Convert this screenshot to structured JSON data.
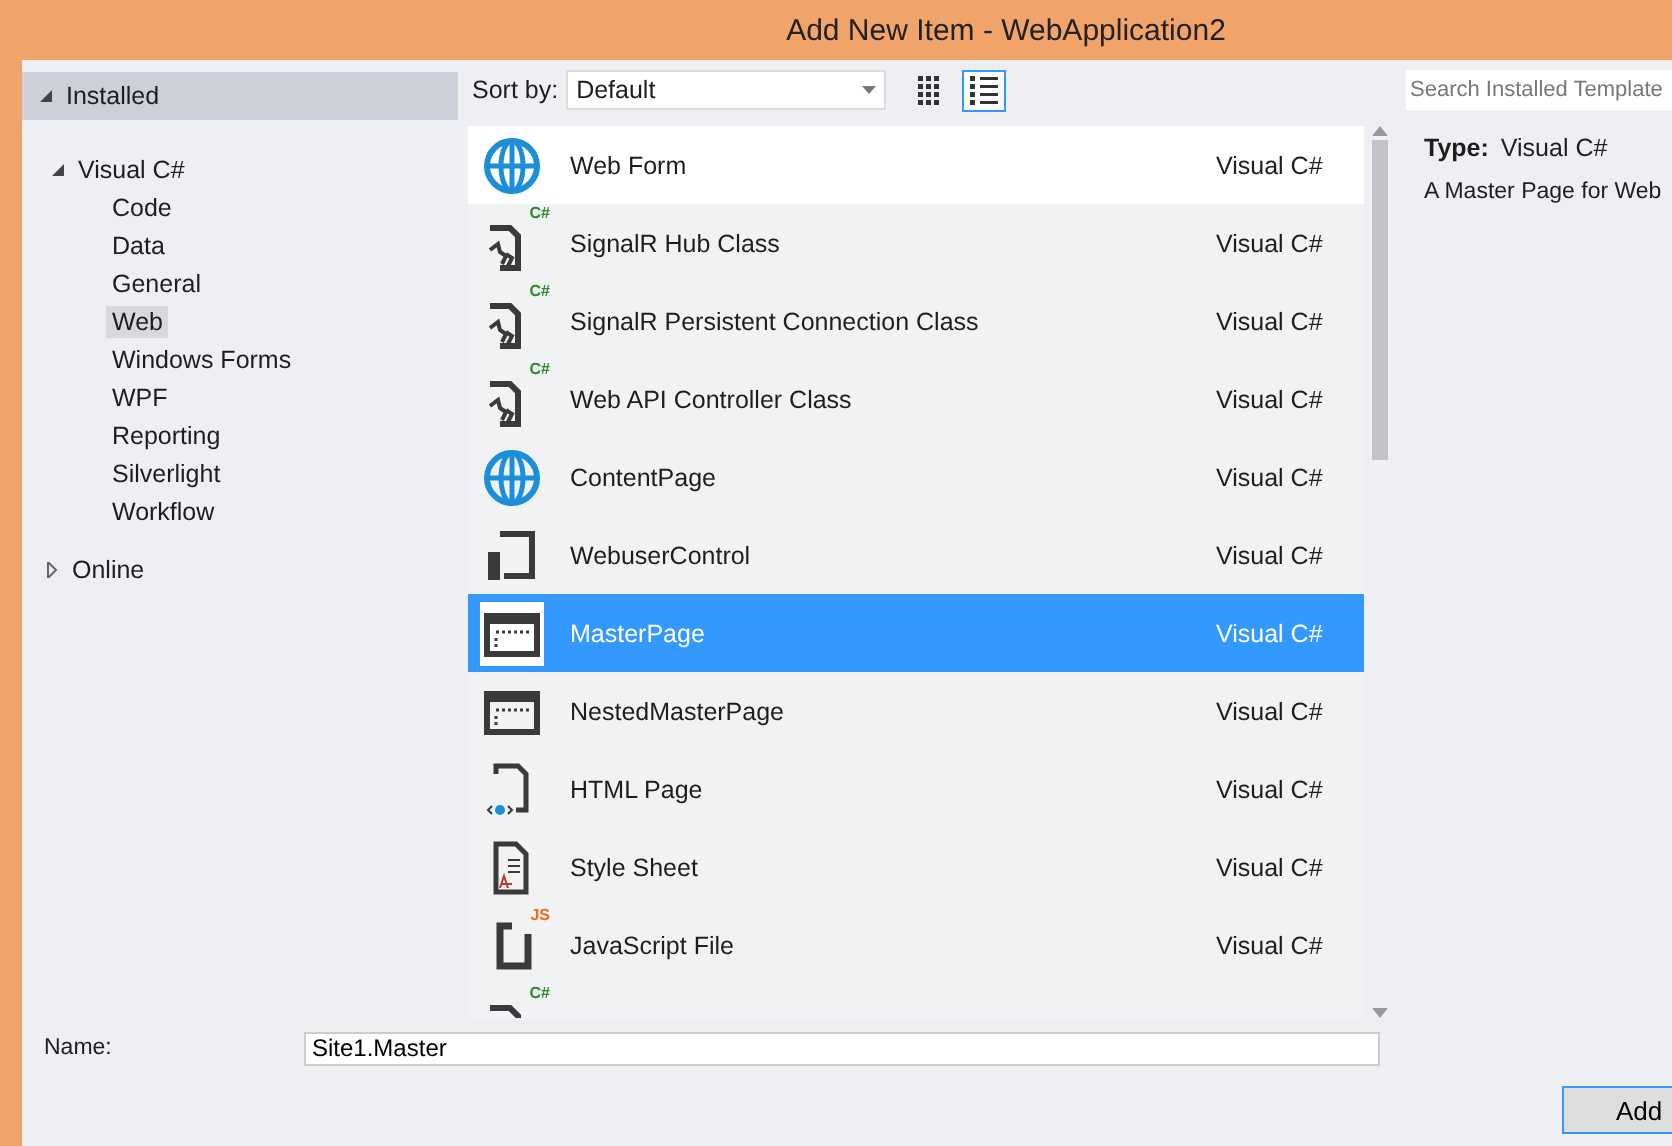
{
  "window": {
    "title": "Add New Item - WebApplication2"
  },
  "tree": [
    {
      "label": "Installed",
      "expanded": true,
      "header": true,
      "selected": false,
      "children": [
        {
          "label": "Visual C#",
          "expanded": true,
          "header": false,
          "selected": false,
          "children": [
            {
              "label": "Code",
              "selected": false
            },
            {
              "label": "Data",
              "selected": false
            },
            {
              "label": "General",
              "selected": false
            },
            {
              "label": "Web",
              "selected": true
            },
            {
              "label": "Windows Forms",
              "selected": false
            },
            {
              "label": "WPF",
              "selected": false
            },
            {
              "label": "Reporting",
              "selected": false
            },
            {
              "label": "Silverlight",
              "selected": false
            },
            {
              "label": "Workflow",
              "selected": false
            }
          ]
        }
      ]
    },
    {
      "label": "Online",
      "expanded": false,
      "header": false,
      "selected": false
    }
  ],
  "toolbar": {
    "sort_label": "Sort by:",
    "sort_value": "Default",
    "view_modes": [
      {
        "kind": "grid",
        "selected": false
      },
      {
        "kind": "list",
        "selected": true
      }
    ]
  },
  "search": {
    "placeholder": "Search Installed Template"
  },
  "templates": [
    {
      "kind": "globe",
      "name": "Web Form",
      "language": "Visual C#",
      "selected": false,
      "hover": true
    },
    {
      "kind": "signalr",
      "badge": "C#",
      "name": "SignalR Hub Class",
      "language": "Visual C#",
      "selected": false,
      "hover": false
    },
    {
      "kind": "signalr",
      "badge": "C#",
      "name": "SignalR Persistent Connection Class",
      "language": "Visual C#",
      "selected": false,
      "hover": false
    },
    {
      "kind": "signalr",
      "badge": "C#",
      "name": "Web API Controller Class",
      "language": "Visual C#",
      "selected": false,
      "hover": false
    },
    {
      "kind": "globe",
      "name": "ContentPage",
      "language": "Visual C#",
      "selected": false,
      "hover": false
    },
    {
      "kind": "control",
      "name": "WebuserControl",
      "language": "Visual C#",
      "selected": false,
      "hover": false
    },
    {
      "kind": "master",
      "name": "MasterPage",
      "language": "Visual C#",
      "selected": true,
      "hover": false
    },
    {
      "kind": "master",
      "name": "NestedMasterPage",
      "language": "Visual C#",
      "selected": false,
      "hover": false
    },
    {
      "kind": "html",
      "name": "HTML Page",
      "language": "Visual C#",
      "selected": false,
      "hover": false
    },
    {
      "kind": "css",
      "name": "Style Sheet",
      "language": "Visual C#",
      "selected": false,
      "hover": false
    },
    {
      "kind": "js",
      "badge": "JS",
      "name": "JavaScript File",
      "language": "Visual C#",
      "selected": false,
      "hover": false
    },
    {
      "kind": "signalr",
      "badge": "C#",
      "selected": false,
      "hover": false
    }
  ],
  "details": {
    "type_label": "Type:",
    "type_value": "Visual C#",
    "description": "A Master Page for Web"
  },
  "name_field": {
    "label": "Name:",
    "value": "Site1.Master"
  },
  "buttons": [
    {
      "label": "Add"
    }
  ]
}
